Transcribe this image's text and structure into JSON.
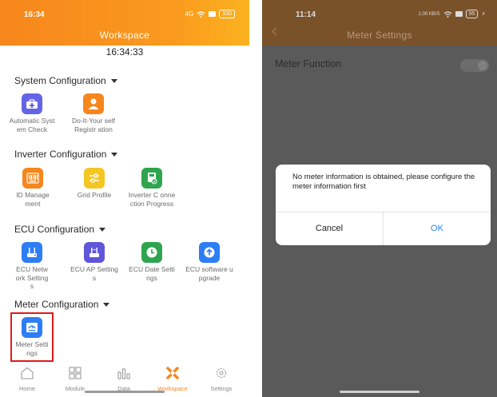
{
  "left": {
    "status_time": "16:34",
    "status_net": "4G",
    "status_battery": "100",
    "title": "Workspace",
    "clock": "16:34:33",
    "sections": {
      "system": {
        "title": "System Configuration",
        "apps": [
          {
            "label": "Automatic System Check",
            "icon": "first-aid-kit-icon"
          },
          {
            "label": "Do-It-Your self Registr ation",
            "icon": "person-icon"
          }
        ]
      },
      "inverter": {
        "title": "Inverter Configuration",
        "apps": [
          {
            "label": "ID Manage ment",
            "icon": "barcode-icon"
          },
          {
            "label": "Grid Profile",
            "icon": "sliders-icon"
          },
          {
            "label": "Inverter C onnection Progress",
            "icon": "inverter-icon"
          }
        ]
      },
      "ecu": {
        "title": "ECU Configuration",
        "apps": [
          {
            "label": "ECU Network Settings",
            "icon": "ecu-network-icon"
          },
          {
            "label": "ECU AP Settings",
            "icon": "ecu-ap-icon"
          },
          {
            "label": "ECU Date Settings",
            "icon": "clock-icon"
          },
          {
            "label": "ECU software upgrade",
            "icon": "upload-arrow-icon"
          }
        ]
      },
      "meter": {
        "title": "Meter Configuration",
        "apps": [
          {
            "label": "Meter Settings",
            "icon": "meter-icon"
          }
        ]
      }
    },
    "tabs": [
      {
        "label": "Home",
        "icon": "home-icon"
      },
      {
        "label": "Module",
        "icon": "grid-icon"
      },
      {
        "label": "Data",
        "icon": "bar-chart-icon"
      },
      {
        "label": "Workspace",
        "icon": "workspace-icon",
        "active": true
      },
      {
        "label": "Settings",
        "icon": "gear-icon"
      }
    ],
    "accent_color": "#f7861c",
    "highlight_color": "#e01a1a"
  },
  "right": {
    "status_time": "11:14",
    "status_net": "1.00 KB/S",
    "status_battery": "95",
    "title": "Meter Settings",
    "meter_function_label": "Meter Function",
    "meter_function_on": false,
    "dialog": {
      "message": "No meter information is obtained, please configure the meter information first",
      "cancel_label": "Cancel",
      "ok_label": "OK"
    },
    "link_color": "#2d7df5"
  }
}
